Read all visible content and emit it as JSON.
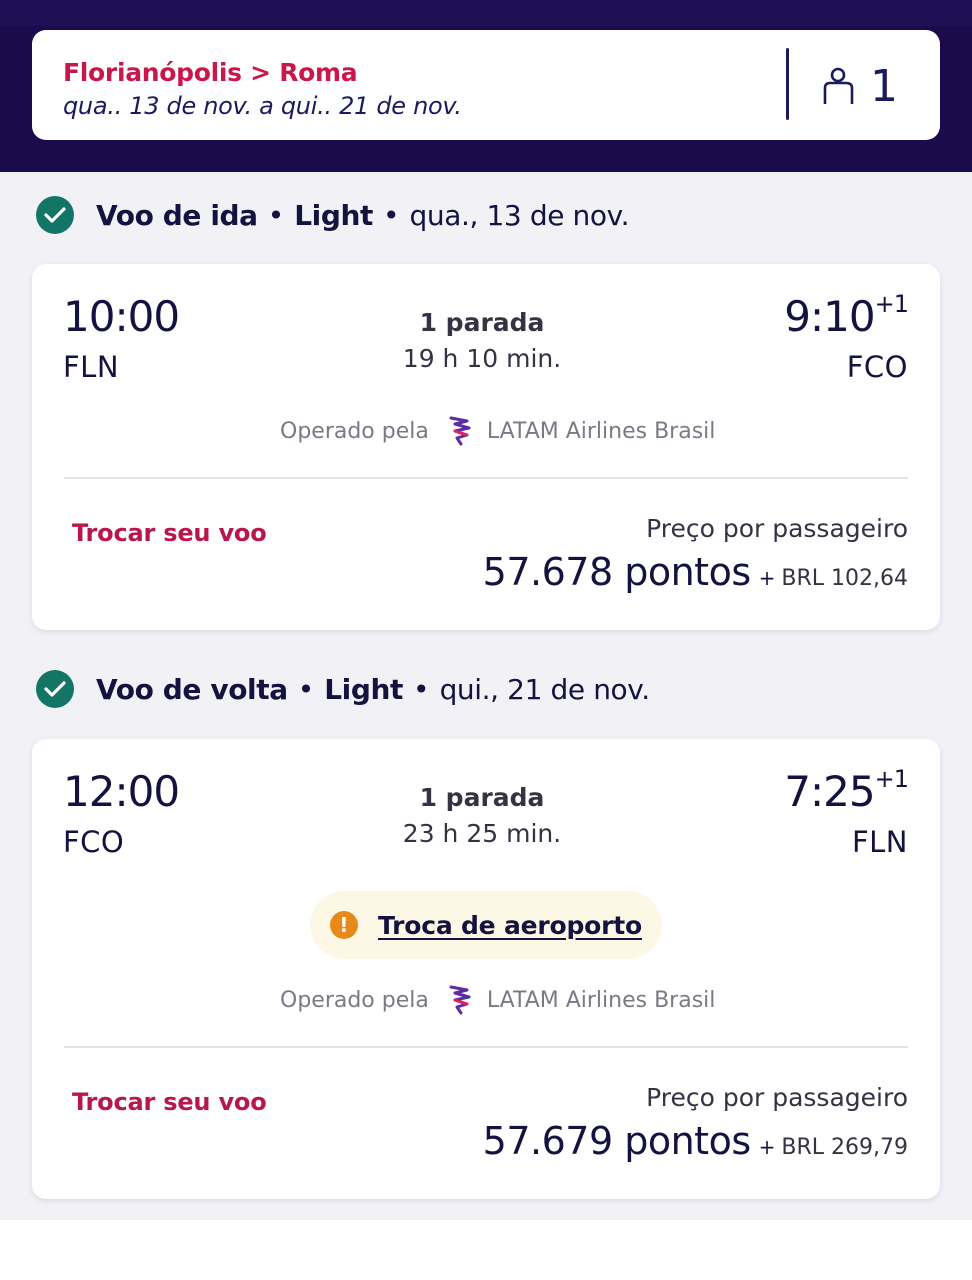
{
  "header": {
    "route": "Florianópolis > Roma",
    "dates": "qua.. 13 de nov. a qui.. 21 de nov.",
    "passenger_count": "1",
    "icons": {
      "passenger": "person-icon"
    }
  },
  "colors": {
    "header_bg": "#1b0a4c",
    "accent": "#c8174b",
    "check": "#137566",
    "warning": "#e88a1a",
    "warning_bg": "#fdf8e6"
  },
  "outbound": {
    "section_title": "Voo de ida",
    "fare": "Light",
    "date": "qua., 13 de nov.",
    "depart_time": "10:00",
    "depart_airport": "FLN",
    "stops": "1 parada",
    "duration": "19 h 10 min.",
    "arrive_time": "9:10",
    "arrive_offset": "+1",
    "arrive_airport": "FCO",
    "operated_by_label": "Operado pela",
    "operator": "LATAM Airlines Brasil",
    "change_link": "Trocar seu voo",
    "price_label": "Preço por passageiro",
    "points": "57.678 pontos",
    "plus": "+",
    "cash": "BRL 102,64"
  },
  "inbound": {
    "section_title": "Voo de volta",
    "fare": "Light",
    "date": "qui., 21 de nov.",
    "depart_time": "12:00",
    "depart_airport": "FCO",
    "stops": "1 parada",
    "duration": "23 h 25 min.",
    "arrive_time": "7:25",
    "arrive_offset": "+1",
    "arrive_airport": "FLN",
    "warning": "Troca de aeroporto",
    "warning_icon_glyph": "!",
    "operated_by_label": "Operado pela",
    "operator": "LATAM Airlines Brasil",
    "change_link": "Trocar seu voo",
    "price_label": "Preço por passageiro",
    "points": "57.679 pontos",
    "plus": "+",
    "cash": "BRL 269,79"
  },
  "separator_dot": "•"
}
